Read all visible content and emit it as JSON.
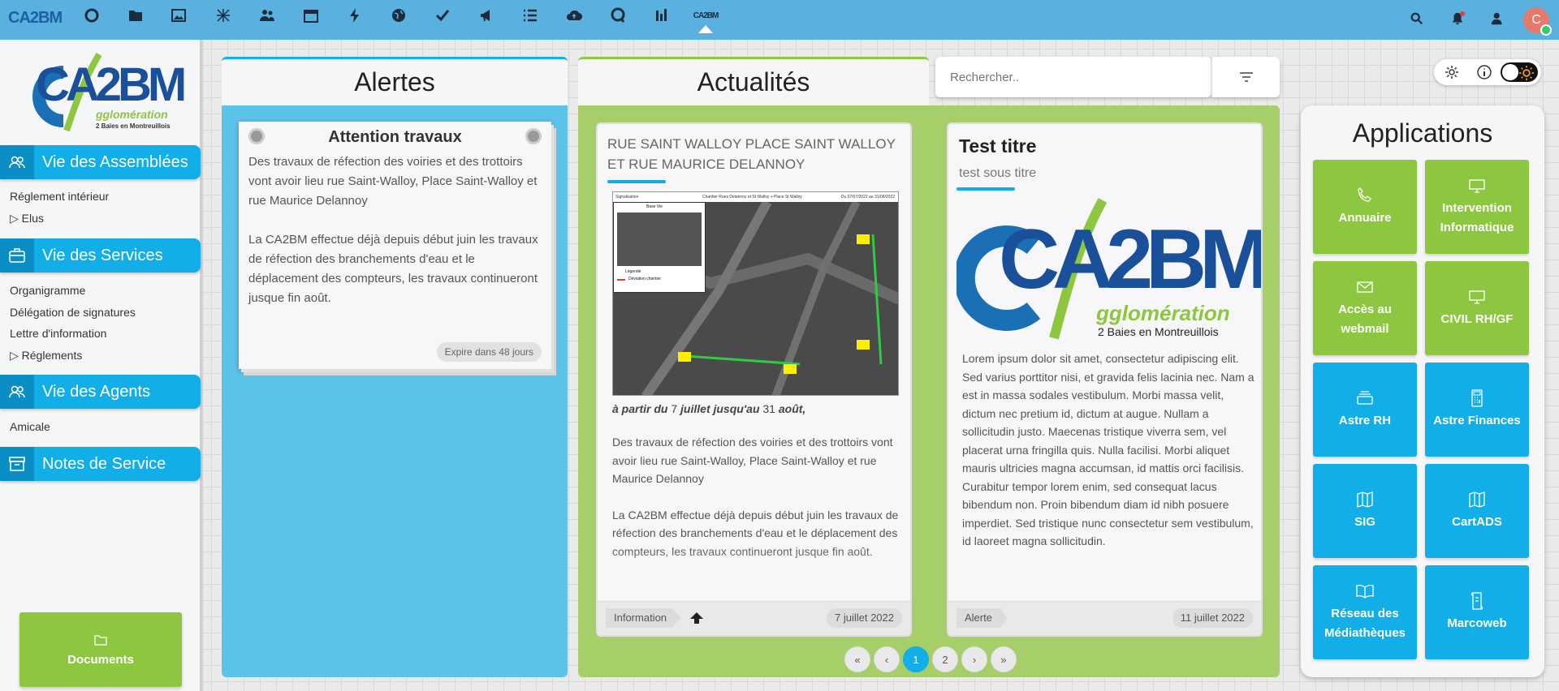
{
  "topbar": {
    "logo_text": "CA2BM",
    "nav_icons": [
      "circle-icon",
      "folder-icon",
      "image-icon",
      "network-icon",
      "users-icon",
      "calendar-icon",
      "bolt-icon",
      "globe-icon",
      "check-icon",
      "megaphone-icon",
      "list-icon",
      "cloud-upload-icon",
      "chat-icon",
      "bar-chart-icon",
      "ca2bm-icon"
    ],
    "right_icons": [
      "search-icon",
      "bell-icon",
      "user-icon"
    ],
    "avatar_initial": "C"
  },
  "sidebar": {
    "logo": {
      "main": "CA2BM",
      "sub": "gglomération",
      "tagline": "2 Baies en Montreuillois"
    },
    "sections": [
      {
        "label": "Vie des Assemblées",
        "icon": "users-icon",
        "links": [
          "Réglement intérieur",
          "▷ Elus"
        ]
      },
      {
        "label": "Vie des Services",
        "icon": "briefcase-icon",
        "links": [
          "Organigramme",
          "Délégation de signatures",
          "Lettre d'information",
          "▷ Réglements"
        ]
      },
      {
        "label": "Vie des Agents",
        "icon": "users-icon",
        "links": [
          "Amicale"
        ]
      },
      {
        "label": "Notes de Service",
        "icon": "archive-icon",
        "links": []
      }
    ],
    "documents_label": "Documents"
  },
  "alerts": {
    "title": "Alertes",
    "card": {
      "title": "Attention travaux",
      "p1": "Des travaux de réfection des voiries et des trottoirs vont avoir lieu rue Saint-Walloy, Place Saint-Walloy et rue Maurice Delannoy",
      "p2": "La CA2BM effectue déjà depuis début juin les travaux de réfection des branchements d'eau et le déplacement des compteurs, les travaux continueront jusque fin août.",
      "expire": "Expire dans 48 jours"
    }
  },
  "news": {
    "title": "Actualités",
    "search_placeholder": "Rechercher..",
    "cards": [
      {
        "title": "RUE SAINT WALLOY PLACE SAINT WALLOY ET RUE MAURICE DELANNOY",
        "date_line_a": "à partir du ",
        "date_line_b": "7",
        "date_line_c": " juillet jusqu'au ",
        "date_line_d": "31",
        "date_line_e": " août,",
        "p1": "Des travaux de réfection des voiries et des trottoirs vont avoir lieu rue Saint-Walloy, Place Saint-Walloy et rue Maurice Delannoy",
        "p2": "La CA2BM effectue déjà depuis début juin les travaux de réfection des branchements d'eau et le déplacement des compteurs, les travaux continueront jusque fin août.",
        "map_header_left": "Signalisation",
        "map_header_mid": "Chantier Rues Delannoy et St Walloy + Place St Walloy",
        "map_header_right": "Du 07/07/2022 au 31/08/2022",
        "map_legend": "Légende",
        "map_legend_item": "Déviation chantier",
        "map_inset_label": "Base Vie",
        "tag": "Information",
        "date": "7 juillet 2022"
      },
      {
        "title": "Test titre",
        "subtitle": "test sous titre",
        "logo_main": "CA2BM",
        "logo_sub": "gglomération",
        "logo_tagline": "2 Baies en Montreuillois",
        "body": "Lorem ipsum dolor sit amet, consectetur adipiscing elit. Sed varius porttitor nisi, et gravida felis lacinia nec. Nam a est in massa sodales vestibulum. Morbi massa velit, dictum nec pretium id, dictum at augue. Nullam a sollicitudin justo. Maecenas tristique viverra sem, vel placerat urna fringilla quis. Nulla facilisi. Morbi aliquet mauris ultricies magna accumsan, id mattis orci facilisis. Curabitur tempor lorem enim, sed consequat lacus bibendum non. Proin bibendum diam id nibh posuere imperdiet. Sed tristique nunc consectetur sem vestibulum, id laoreet magna sollicitudin.",
        "tag": "Alerte",
        "date": "11 juillet 2022"
      }
    ],
    "pagination": [
      "«",
      "‹",
      "1",
      "2",
      "›",
      "»"
    ]
  },
  "applications": {
    "title": "Applications",
    "tiles": [
      {
        "label": "Annuaire",
        "icon": "phone-icon",
        "color": "#8dc63f"
      },
      {
        "label": "Intervention Informatique",
        "icon": "monitor-icon",
        "color": "#8dc63f"
      },
      {
        "label": "Accès au webmail",
        "icon": "mail-icon",
        "color": "#8dc63f"
      },
      {
        "label": "CIVIL RH/GF",
        "icon": "monitor-icon",
        "color": "#8dc63f"
      },
      {
        "label": "Astre RH",
        "icon": "stack-icon",
        "color": "#11aee8"
      },
      {
        "label": "Astre Finances",
        "icon": "calculator-icon",
        "color": "#11aee8"
      },
      {
        "label": "SIG",
        "icon": "map-icon",
        "color": "#11aee8"
      },
      {
        "label": "CartADS",
        "icon": "map-icon",
        "color": "#11aee8"
      },
      {
        "label": "Réseau des Médiathèques",
        "icon": "book-icon",
        "color": "#11aee8"
      },
      {
        "label": "Marcoweb",
        "icon": "document-icon",
        "color": "#11aee8"
      }
    ]
  },
  "settings": {
    "icons": [
      "gear-icon",
      "info-icon",
      "sun-icon"
    ]
  }
}
